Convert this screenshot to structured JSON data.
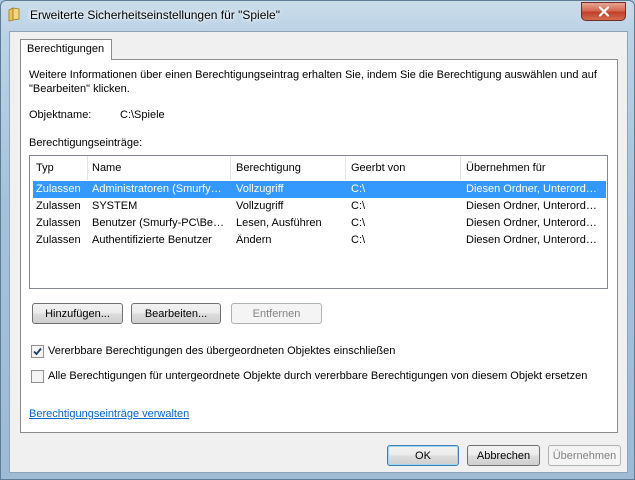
{
  "window": {
    "title": "Erweiterte Sicherheitseinstellungen für \"Spiele\"",
    "icon": "folder-icon",
    "close_icon": "close-icon"
  },
  "tabs": [
    {
      "label": "Berechtigungen",
      "active": true
    }
  ],
  "info_text": "Weitere Informationen über einen Berechtigungseintrag erhalten Sie, indem Sie die Berechtigung auswählen und auf \"Bearbeiten\" klicken.",
  "object": {
    "label": "Objektname:",
    "value": "C:\\Spiele"
  },
  "entries_label": "Berechtigungseinträge:",
  "table": {
    "columns": [
      "Typ",
      "Name",
      "Berechtigung",
      "Geerbt von",
      "Übernehmen für"
    ],
    "rows": [
      {
        "typ": "Zulassen",
        "name": "Administratoren (Smurfy…",
        "berechtigung": "Vollzugriff",
        "geerbt": "C:\\",
        "uebernehmen": "Diesen Ordner, Unterord…",
        "selected": true
      },
      {
        "typ": "Zulassen",
        "name": "SYSTEM",
        "berechtigung": "Vollzugriff",
        "geerbt": "C:\\",
        "uebernehmen": "Diesen Ordner, Unterord…",
        "selected": false
      },
      {
        "typ": "Zulassen",
        "name": "Benutzer (Smurfy-PC\\Be…",
        "berechtigung": "Lesen, Ausführen",
        "geerbt": "C:\\",
        "uebernehmen": "Diesen Ordner, Unterord…",
        "selected": false
      },
      {
        "typ": "Zulassen",
        "name": "Authentifizierte Benutzer",
        "berechtigung": "Ändern",
        "geerbt": "C:\\",
        "uebernehmen": "Diesen Ordner, Unterord…",
        "selected": false
      }
    ]
  },
  "buttons": {
    "add": "Hinzufügen...",
    "edit": "Bearbeiten...",
    "remove": "Entfernen",
    "ok": "OK",
    "cancel": "Abbrechen",
    "apply": "Übernehmen"
  },
  "checkboxes": [
    {
      "label": "Vererbbare Berechtigungen des übergeordneten Objektes einschließen",
      "checked": true
    },
    {
      "label": "Alle Berechtigungen für untergeordnete Objekte durch vererbbare Berechtigungen von diesem Objekt ersetzen",
      "checked": false
    }
  ],
  "manage_link": "Berechtigungseinträge verwalten"
}
